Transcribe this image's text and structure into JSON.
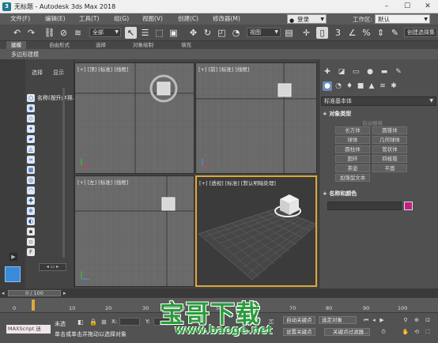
{
  "window": {
    "title": "无标题 - Autodesk 3ds Max 2018",
    "app_icon": "3ds-max-icon"
  },
  "menu": {
    "items": [
      "文件(F)",
      "编辑(E)",
      "工具(T)",
      "组(G)",
      "视图(V)",
      "创建(C)",
      "修改器(M)"
    ],
    "signin": "登录",
    "workspace_label": "工作区:",
    "workspace_value": "默认"
  },
  "toolbar": {
    "selection_filter": "全部",
    "ref_coord": "视图",
    "named_sets": "创建选择集"
  },
  "ribbon": {
    "tabs": [
      "建模",
      "自由形式",
      "选择",
      "对象绘制",
      "填充"
    ],
    "active_tab": "建模",
    "subtitle": "多边形建模"
  },
  "scene_explorer": {
    "tabs": [
      "选择",
      "显示"
    ],
    "node_label": "名称(按升序排..."
  },
  "viewports": {
    "top": "[+] [顶] [标准] [线框]",
    "front": "[+] [前] [标准] [线框]",
    "left": "[+] [左] [标准] [线框]",
    "perspective": "[+] [透视] [标准] [默认明暗处理]"
  },
  "command_panel": {
    "category": "标准基本体",
    "object_type_header": "对象类型",
    "autogrid": "自动栅格",
    "buttons": [
      "长方体",
      "圆锥体",
      "球体",
      "几何球体",
      "圆柱体",
      "管状体",
      "圆环",
      "四棱锥",
      "茶壶",
      "平面",
      "加强型文本"
    ],
    "name_color_header": "名称和颜色",
    "object_color": "#c41e82"
  },
  "timeline": {
    "frame_display": "0 / 100",
    "ticks": [
      "0",
      "10",
      "20",
      "30",
      "40",
      "50",
      "60",
      "70",
      "80",
      "90",
      "100"
    ]
  },
  "status": {
    "maxscript": "MAXScript 迷",
    "line1": "未选",
    "line2": "单击或单击并拖动以选择对象",
    "x_label": "X:",
    "y_label": "Y:",
    "autokey": "自动关键点",
    "selected_object": "选定对象",
    "set_key": "设置关键点",
    "key_filter": "关键点过滤器..."
  },
  "watermark": {
    "text": "宝哥下载",
    "url": "www.baoge.net"
  }
}
